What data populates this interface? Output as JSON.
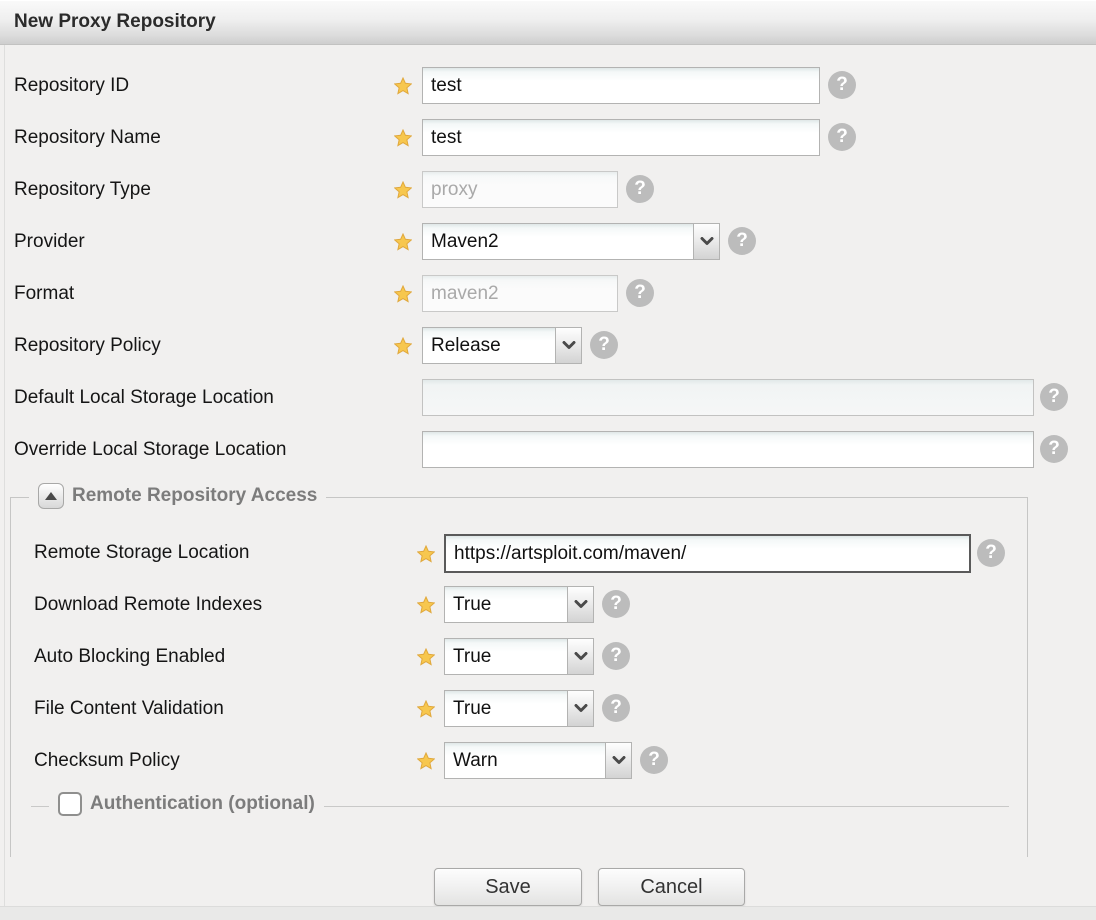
{
  "header": {
    "title": "New Proxy Repository"
  },
  "icons": {
    "help_glyph": "?"
  },
  "colors": {
    "required_star": "#F7C74E",
    "legend_text": "#7C7C7C",
    "focused_border": "#5A5A5A",
    "help_icon_bg": "#BCBCBC"
  },
  "form": {
    "repository_id": {
      "label": "Repository ID",
      "value": "test",
      "required": true
    },
    "repository_name": {
      "label": "Repository Name",
      "value": "test",
      "required": true
    },
    "repository_type": {
      "label": "Repository Type",
      "value": "proxy",
      "required": true,
      "disabled": true
    },
    "provider": {
      "label": "Provider",
      "value": "Maven2",
      "required": true
    },
    "format": {
      "label": "Format",
      "value": "maven2",
      "required": true,
      "disabled": true
    },
    "repository_policy": {
      "label": "Repository Policy",
      "value": "Release",
      "required": true
    },
    "default_local_storage": {
      "label": "Default Local Storage Location",
      "value": ""
    },
    "override_local_storage": {
      "label": "Override Local Storage Location",
      "value": ""
    }
  },
  "remote_access": {
    "legend": "Remote Repository Access",
    "remote_storage": {
      "label": "Remote Storage Location",
      "value": "https://artsploit.com/maven/",
      "required": true,
      "focused": true
    },
    "download_remote_indexes": {
      "label": "Download Remote Indexes",
      "value": "True",
      "required": true
    },
    "auto_blocking_enabled": {
      "label": "Auto Blocking Enabled",
      "value": "True",
      "required": true
    },
    "file_content_validation": {
      "label": "File Content Validation",
      "value": "True",
      "required": true
    },
    "checksum_policy": {
      "label": "Checksum Policy",
      "value": "Warn",
      "required": true
    },
    "authentication": {
      "legend": "Authentication (optional)",
      "checked": false
    }
  },
  "footer": {
    "save_label": "Save",
    "cancel_label": "Cancel"
  }
}
